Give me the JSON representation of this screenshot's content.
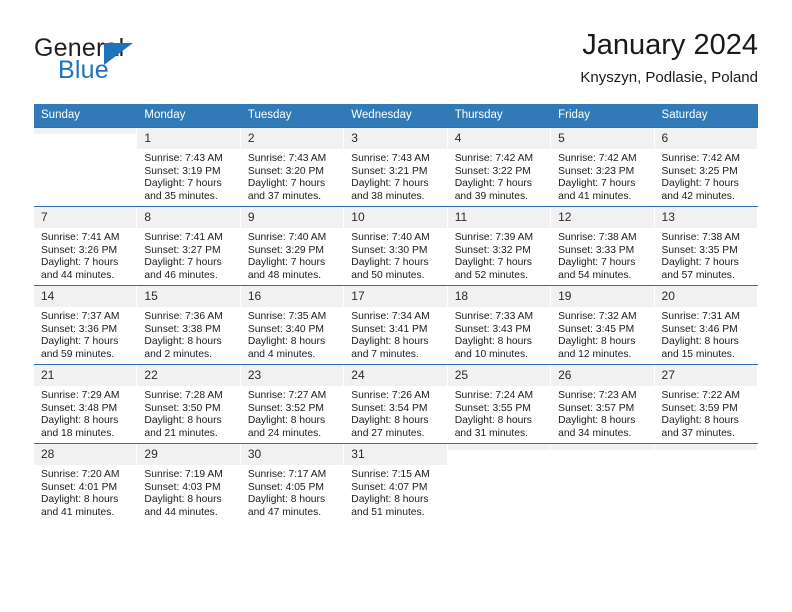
{
  "brand": {
    "name_part1": "General",
    "name_part2": "Blue",
    "triangle_color": "#1f73bd",
    "text_color": "#231f20"
  },
  "header": {
    "title": "January 2024",
    "subtitle": "Knyszyn, Podlasie, Poland",
    "header_bg_color": "#3279b8",
    "row_line_color": "#2e72ad",
    "daynum_bg_color": "#f1f1f1"
  },
  "weekdays": [
    "Sunday",
    "Monday",
    "Tuesday",
    "Wednesday",
    "Thursday",
    "Friday",
    "Saturday"
  ],
  "weeks": [
    [
      {
        "day": "",
        "sunrise": "",
        "sunset": "",
        "daylight1": "",
        "daylight2": "",
        "empty": true
      },
      {
        "day": "1",
        "sunrise": "Sunrise: 7:43 AM",
        "sunset": "Sunset: 3:19 PM",
        "daylight1": "Daylight: 7 hours",
        "daylight2": "and 35 minutes."
      },
      {
        "day": "2",
        "sunrise": "Sunrise: 7:43 AM",
        "sunset": "Sunset: 3:20 PM",
        "daylight1": "Daylight: 7 hours",
        "daylight2": "and 37 minutes."
      },
      {
        "day": "3",
        "sunrise": "Sunrise: 7:43 AM",
        "sunset": "Sunset: 3:21 PM",
        "daylight1": "Daylight: 7 hours",
        "daylight2": "and 38 minutes."
      },
      {
        "day": "4",
        "sunrise": "Sunrise: 7:42 AM",
        "sunset": "Sunset: 3:22 PM",
        "daylight1": "Daylight: 7 hours",
        "daylight2": "and 39 minutes."
      },
      {
        "day": "5",
        "sunrise": "Sunrise: 7:42 AM",
        "sunset": "Sunset: 3:23 PM",
        "daylight1": "Daylight: 7 hours",
        "daylight2": "and 41 minutes."
      },
      {
        "day": "6",
        "sunrise": "Sunrise: 7:42 AM",
        "sunset": "Sunset: 3:25 PM",
        "daylight1": "Daylight: 7 hours",
        "daylight2": "and 42 minutes."
      }
    ],
    [
      {
        "day": "7",
        "sunrise": "Sunrise: 7:41 AM",
        "sunset": "Sunset: 3:26 PM",
        "daylight1": "Daylight: 7 hours",
        "daylight2": "and 44 minutes."
      },
      {
        "day": "8",
        "sunrise": "Sunrise: 7:41 AM",
        "sunset": "Sunset: 3:27 PM",
        "daylight1": "Daylight: 7 hours",
        "daylight2": "and 46 minutes."
      },
      {
        "day": "9",
        "sunrise": "Sunrise: 7:40 AM",
        "sunset": "Sunset: 3:29 PM",
        "daylight1": "Daylight: 7 hours",
        "daylight2": "and 48 minutes."
      },
      {
        "day": "10",
        "sunrise": "Sunrise: 7:40 AM",
        "sunset": "Sunset: 3:30 PM",
        "daylight1": "Daylight: 7 hours",
        "daylight2": "and 50 minutes."
      },
      {
        "day": "11",
        "sunrise": "Sunrise: 7:39 AM",
        "sunset": "Sunset: 3:32 PM",
        "daylight1": "Daylight: 7 hours",
        "daylight2": "and 52 minutes."
      },
      {
        "day": "12",
        "sunrise": "Sunrise: 7:38 AM",
        "sunset": "Sunset: 3:33 PM",
        "daylight1": "Daylight: 7 hours",
        "daylight2": "and 54 minutes."
      },
      {
        "day": "13",
        "sunrise": "Sunrise: 7:38 AM",
        "sunset": "Sunset: 3:35 PM",
        "daylight1": "Daylight: 7 hours",
        "daylight2": "and 57 minutes."
      }
    ],
    [
      {
        "day": "14",
        "sunrise": "Sunrise: 7:37 AM",
        "sunset": "Sunset: 3:36 PM",
        "daylight1": "Daylight: 7 hours",
        "daylight2": "and 59 minutes."
      },
      {
        "day": "15",
        "sunrise": "Sunrise: 7:36 AM",
        "sunset": "Sunset: 3:38 PM",
        "daylight1": "Daylight: 8 hours",
        "daylight2": "and 2 minutes."
      },
      {
        "day": "16",
        "sunrise": "Sunrise: 7:35 AM",
        "sunset": "Sunset: 3:40 PM",
        "daylight1": "Daylight: 8 hours",
        "daylight2": "and 4 minutes."
      },
      {
        "day": "17",
        "sunrise": "Sunrise: 7:34 AM",
        "sunset": "Sunset: 3:41 PM",
        "daylight1": "Daylight: 8 hours",
        "daylight2": "and 7 minutes."
      },
      {
        "day": "18",
        "sunrise": "Sunrise: 7:33 AM",
        "sunset": "Sunset: 3:43 PM",
        "daylight1": "Daylight: 8 hours",
        "daylight2": "and 10 minutes."
      },
      {
        "day": "19",
        "sunrise": "Sunrise: 7:32 AM",
        "sunset": "Sunset: 3:45 PM",
        "daylight1": "Daylight: 8 hours",
        "daylight2": "and 12 minutes."
      },
      {
        "day": "20",
        "sunrise": "Sunrise: 7:31 AM",
        "sunset": "Sunset: 3:46 PM",
        "daylight1": "Daylight: 8 hours",
        "daylight2": "and 15 minutes."
      }
    ],
    [
      {
        "day": "21",
        "sunrise": "Sunrise: 7:29 AM",
        "sunset": "Sunset: 3:48 PM",
        "daylight1": "Daylight: 8 hours",
        "daylight2": "and 18 minutes."
      },
      {
        "day": "22",
        "sunrise": "Sunrise: 7:28 AM",
        "sunset": "Sunset: 3:50 PM",
        "daylight1": "Daylight: 8 hours",
        "daylight2": "and 21 minutes."
      },
      {
        "day": "23",
        "sunrise": "Sunrise: 7:27 AM",
        "sunset": "Sunset: 3:52 PM",
        "daylight1": "Daylight: 8 hours",
        "daylight2": "and 24 minutes."
      },
      {
        "day": "24",
        "sunrise": "Sunrise: 7:26 AM",
        "sunset": "Sunset: 3:54 PM",
        "daylight1": "Daylight: 8 hours",
        "daylight2": "and 27 minutes."
      },
      {
        "day": "25",
        "sunrise": "Sunrise: 7:24 AM",
        "sunset": "Sunset: 3:55 PM",
        "daylight1": "Daylight: 8 hours",
        "daylight2": "and 31 minutes."
      },
      {
        "day": "26",
        "sunrise": "Sunrise: 7:23 AM",
        "sunset": "Sunset: 3:57 PM",
        "daylight1": "Daylight: 8 hours",
        "daylight2": "and 34 minutes."
      },
      {
        "day": "27",
        "sunrise": "Sunrise: 7:22 AM",
        "sunset": "Sunset: 3:59 PM",
        "daylight1": "Daylight: 8 hours",
        "daylight2": "and 37 minutes."
      }
    ],
    [
      {
        "day": "28",
        "sunrise": "Sunrise: 7:20 AM",
        "sunset": "Sunset: 4:01 PM",
        "daylight1": "Daylight: 8 hours",
        "daylight2": "and 41 minutes."
      },
      {
        "day": "29",
        "sunrise": "Sunrise: 7:19 AM",
        "sunset": "Sunset: 4:03 PM",
        "daylight1": "Daylight: 8 hours",
        "daylight2": "and 44 minutes."
      },
      {
        "day": "30",
        "sunrise": "Sunrise: 7:17 AM",
        "sunset": "Sunset: 4:05 PM",
        "daylight1": "Daylight: 8 hours",
        "daylight2": "and 47 minutes."
      },
      {
        "day": "31",
        "sunrise": "Sunrise: 7:15 AM",
        "sunset": "Sunset: 4:07 PM",
        "daylight1": "Daylight: 8 hours",
        "daylight2": "and 51 minutes."
      },
      {
        "day": "",
        "sunrise": "",
        "sunset": "",
        "daylight1": "",
        "daylight2": "",
        "empty": true
      },
      {
        "day": "",
        "sunrise": "",
        "sunset": "",
        "daylight1": "",
        "daylight2": "",
        "empty": true
      },
      {
        "day": "",
        "sunrise": "",
        "sunset": "",
        "daylight1": "",
        "daylight2": "",
        "empty": true
      }
    ]
  ]
}
